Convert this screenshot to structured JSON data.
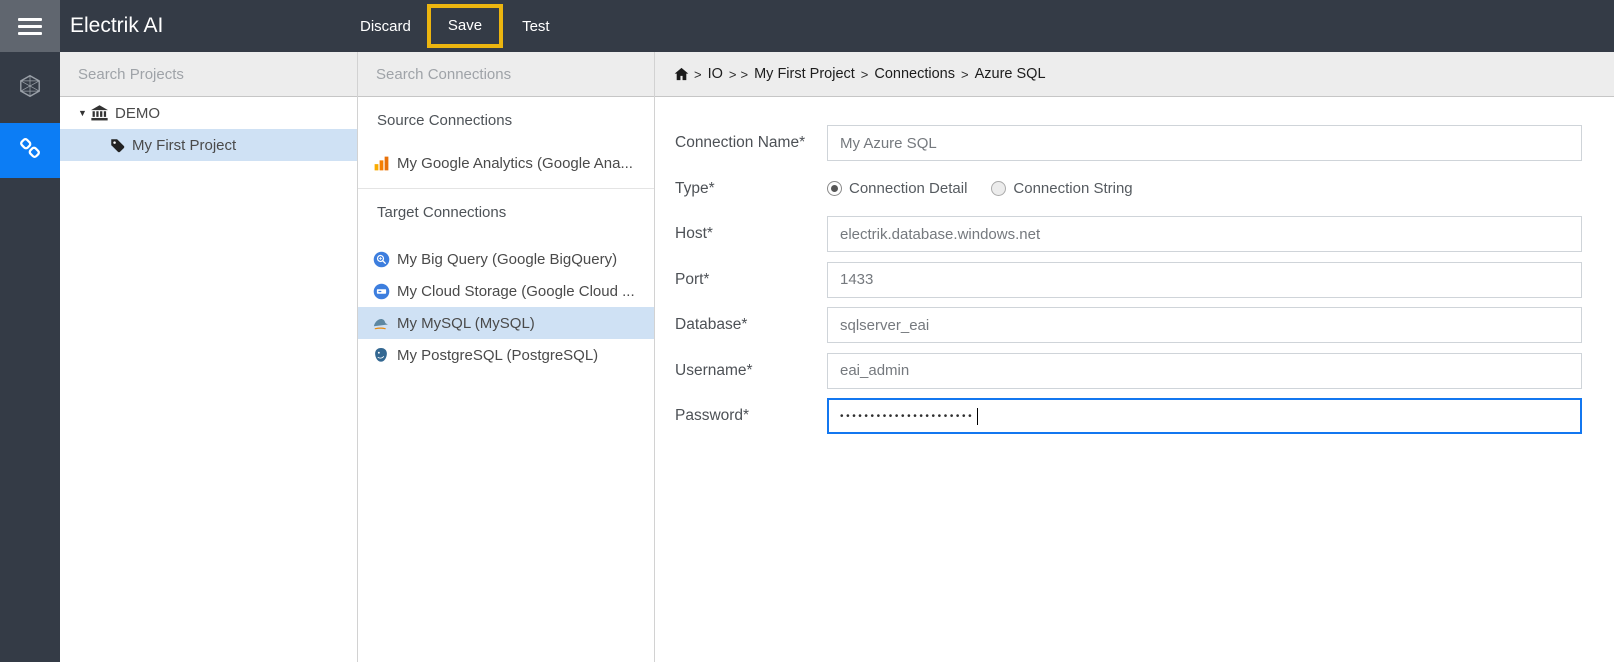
{
  "navbar": {
    "title": "Electrik AI",
    "discard_label": "Discard",
    "save_label": "Save",
    "test_label": "Test",
    "save_highlight_color": "#ecb50f",
    "background_color": "#343b46"
  },
  "sidebar": {
    "active_color": "#0c7df5",
    "items": [
      {
        "name": "hexagon",
        "icon": "hexagon-icon",
        "active": false
      },
      {
        "name": "connections",
        "icon": "link-icon",
        "active": true
      }
    ]
  },
  "projects_panel": {
    "search_placeholder": "Search Projects",
    "tree": [
      {
        "label": "DEMO",
        "icon": "bank-icon",
        "caret": "▼",
        "expanded": true,
        "selected": false
      },
      {
        "label": "My First Project",
        "icon": "tag-icon",
        "selected": true
      }
    ]
  },
  "connections_panel": {
    "search_placeholder": "Search Connections",
    "source_section": {
      "title": "Source Connections",
      "items": [
        {
          "label": "My Google Analytics (Google Ana...",
          "icon": "google-analytics-icon",
          "selected": false
        }
      ]
    },
    "target_section": {
      "title": "Target Connections",
      "items": [
        {
          "label": "My Big Query (Google BigQuery)",
          "icon": "bigquery-icon",
          "selected": false
        },
        {
          "label": "My Cloud Storage (Google Cloud ...",
          "icon": "cloud-storage-icon",
          "selected": false
        },
        {
          "label": "My MySQL (MySQL)",
          "icon": "mysql-icon",
          "selected": true
        },
        {
          "label": "My PostgreSQL (PostgreSQL)",
          "icon": "postgresql-icon",
          "selected": false
        }
      ]
    }
  },
  "breadcrumb": {
    "home_icon": "home-icon",
    "separator": ">",
    "items": [
      "IO",
      "My First Project",
      "Connections",
      "Azure SQL"
    ]
  },
  "form": {
    "fields": {
      "connection_name": {
        "label": "Connection Name*",
        "value": "My Azure SQL"
      },
      "type": {
        "label": "Type*",
        "options": [
          {
            "label": "Connection Detail",
            "selected": true
          },
          {
            "label": "Connection String",
            "selected": false
          }
        ]
      },
      "host": {
        "label": "Host*",
        "value": "electrik.database.windows.net"
      },
      "port": {
        "label": "Port*",
        "value": "1433"
      },
      "database": {
        "label": "Database*",
        "value": "sqlserver_eai"
      },
      "username": {
        "label": "Username*",
        "value": "eai_admin"
      },
      "password": {
        "label": "Password*",
        "value": "••••••••••••••••••••••",
        "masked": true,
        "focused": true,
        "focus_border_color": "#1377f0"
      }
    }
  }
}
